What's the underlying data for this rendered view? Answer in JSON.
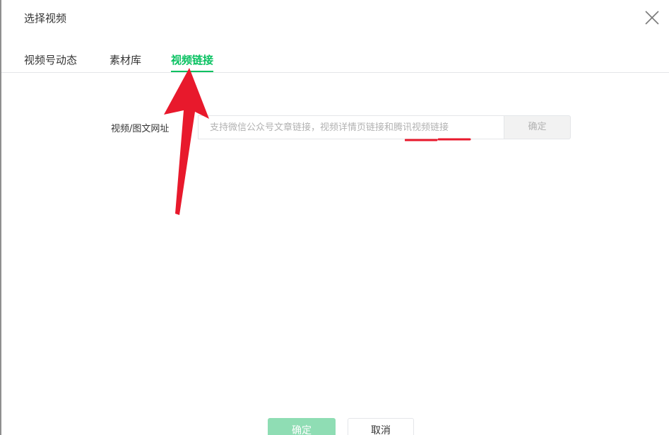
{
  "dialog": {
    "title": "选择视频",
    "close_icon": "close-icon"
  },
  "tabs": [
    {
      "label": "视频号动态",
      "active": false
    },
    {
      "label": "素材库",
      "active": false
    },
    {
      "label": "视频链接",
      "active": true
    }
  ],
  "form": {
    "label": "视频/图文网址",
    "placeholder": "支持微信公众号文章链接，视频详情页链接和腾讯视频链接",
    "value": "",
    "confirm_label": "确定"
  },
  "footer": {
    "confirm_label": "确定",
    "cancel_label": "取消"
  },
  "colors": {
    "accent": "#07c160",
    "annotation": "#e8192c"
  }
}
